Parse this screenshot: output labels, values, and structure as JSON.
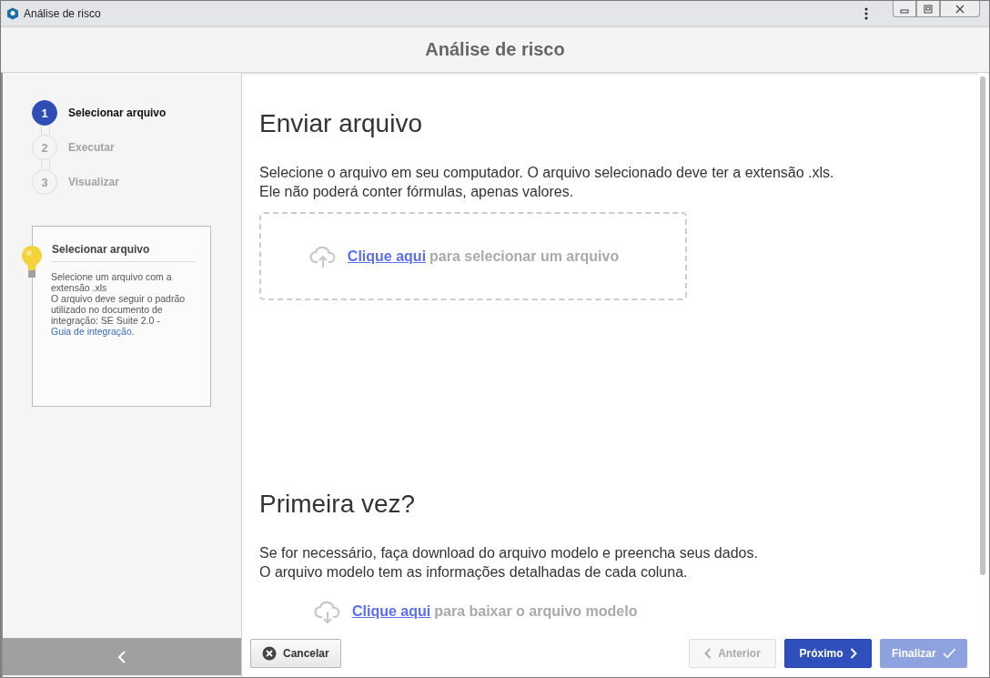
{
  "window": {
    "title": "Análise de risco"
  },
  "header": {
    "title": "Análise de risco"
  },
  "steps": [
    {
      "number": "1",
      "label": "Selecionar arquivo",
      "selected": true
    },
    {
      "number": "2",
      "label": "Executar",
      "selected": false
    },
    {
      "number": "3",
      "label": "Visualizar",
      "selected": false
    }
  ],
  "help": {
    "title": "Selecionar arquivo",
    "lines": [
      "Selecione um arquivo com a extensão .xls",
      "O arquivo deve seguir o padrão utilizado no documento de integração: SE Suite 2.0 - "
    ],
    "link": "Guia de integração."
  },
  "upload": {
    "heading": "Enviar arquivo",
    "description": [
      "Selecione o arquivo em seu computador. O arquivo selecionado deve ter a extensão .xls.",
      "Ele não poderá conter fórmulas, apenas valores."
    ],
    "link": "Clique aqui",
    "text": "para selecionar um arquivo"
  },
  "first_time": {
    "heading": "Primeira vez?",
    "description": [
      "Se for necessário, faça download do arquivo modelo e preencha seus dados.",
      "O arquivo modelo tem as informações detalhadas de cada coluna."
    ],
    "link": "Clique aqui",
    "text": "para baixar o arquivo modelo"
  },
  "buttons": [
    {
      "kind": "cancel",
      "label": "Cancelar",
      "disabled": false
    },
    {
      "kind": "previous",
      "label": "Anterior",
      "disabled": true
    },
    {
      "kind": "next",
      "label": "Próximo",
      "disabled": false
    },
    {
      "kind": "finish",
      "label": "Finalizar",
      "disabled": true
    }
  ]
}
